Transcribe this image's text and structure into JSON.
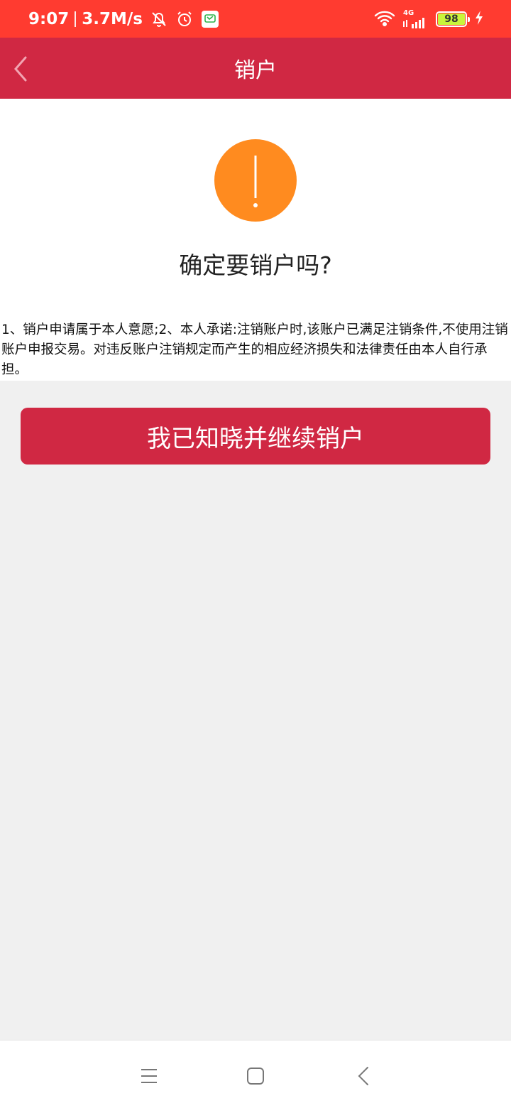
{
  "status_bar": {
    "time": "9:07",
    "speed": "3.7M/s",
    "network": "4G",
    "battery": "98",
    "icons": [
      "bell-off-icon",
      "alarm-icon",
      "app-notification-icon",
      "wifi-icon",
      "signal-icon",
      "battery-icon",
      "charging-icon"
    ]
  },
  "header": {
    "title": "销户",
    "back_icon": "chevron-left-icon"
  },
  "main": {
    "warning_icon": "exclamation-icon",
    "confirm_title": "确定要销户吗?",
    "terms_text": "1、销户申请属于本人意愿;2、本人承诺:注销账户时,该账户已满足注销条件,不使用注销账户申报交易。对违反账户注销规定而产生的相应经济损失和法律责任由本人自行承担。",
    "button_label": "我已知晓并继续销户"
  },
  "colors": {
    "status_bar": "#ff3b30",
    "header": "#d02843",
    "warning": "#ff8b1f",
    "button": "#d02843"
  },
  "nav_bar": {
    "icons": [
      "menu-icon",
      "home-icon",
      "back-icon"
    ]
  }
}
